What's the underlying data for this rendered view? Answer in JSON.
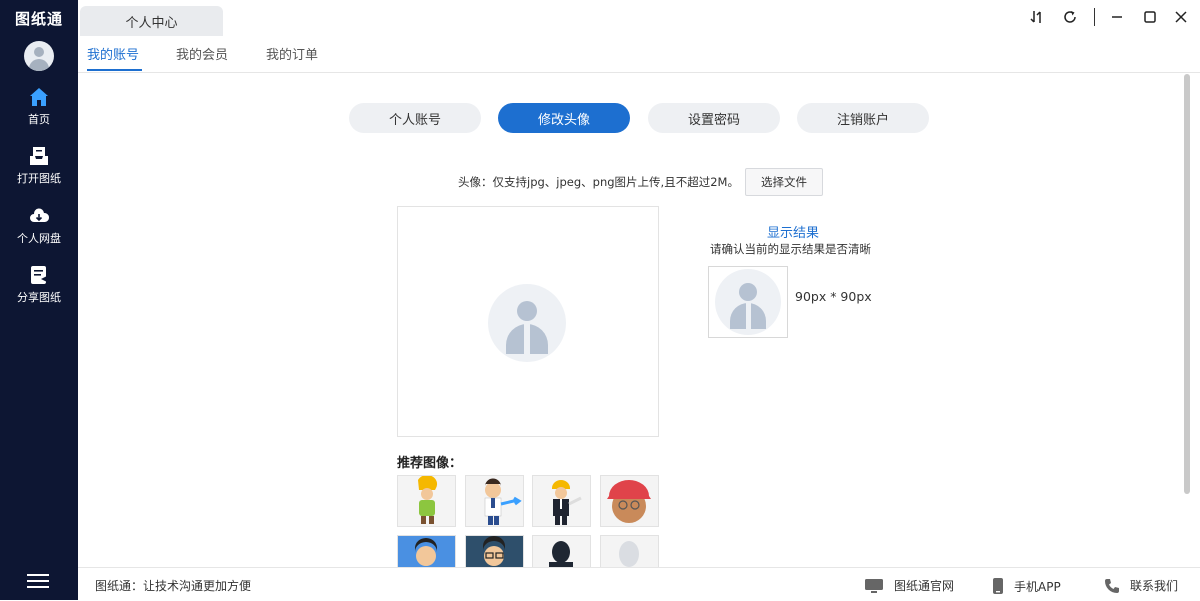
{
  "app": {
    "logo": "图纸通"
  },
  "sidebar": {
    "items": [
      {
        "label": "首页",
        "icon": "home-icon"
      },
      {
        "label": "打开图纸",
        "icon": "inbox-icon"
      },
      {
        "label": "个人网盘",
        "icon": "cloud-icon"
      },
      {
        "label": "分享图纸",
        "icon": "share-doc-icon"
      }
    ],
    "bg_color": "#0d1633"
  },
  "tab": {
    "title": "个人中心"
  },
  "subtabs": [
    "我的账号",
    "我的会员",
    "我的订单"
  ],
  "pills": [
    "个人账号",
    "修改头像",
    "设置密码",
    "注销账户"
  ],
  "upload": {
    "hint": "头像：仅支持jpg、jpeg、png图片上传,且不超过2M。",
    "button": "选择文件"
  },
  "result": {
    "title": "显示结果",
    "subtitle": "请确认当前的显示结果是否清晰",
    "size": "90px * 90px"
  },
  "recommended": {
    "title": "推荐图像："
  },
  "status": {
    "text": "图纸通：让技术沟通更加方便",
    "links": [
      "图纸通官网",
      "手机APP",
      "联系我们"
    ]
  },
  "accent": "#1d6fd0"
}
